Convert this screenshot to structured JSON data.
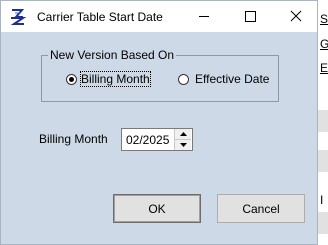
{
  "window": {
    "title": "Carrier Table Start Date",
    "controls": {
      "minimize": "minimize",
      "maximize": "maximize",
      "close": "close"
    }
  },
  "group": {
    "label": "New Version Based On",
    "options": [
      {
        "label": "Billing Month",
        "selected": true
      },
      {
        "label": "Effective Date",
        "selected": false
      }
    ]
  },
  "field": {
    "label": "Billing Month",
    "value": "02/2025"
  },
  "buttons": {
    "ok": "OK",
    "cancel": "Cancel"
  },
  "background": {
    "links": [
      "S",
      "G",
      "E"
    ],
    "edge_text": "I"
  },
  "colors": {
    "dialog_bg": "#ced9e7",
    "titlebar_bg": "#ffffff",
    "button_bg": "#e1e1e1"
  }
}
